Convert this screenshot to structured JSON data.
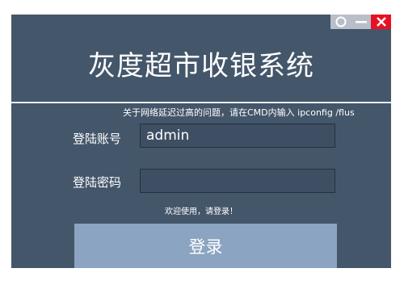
{
  "window": {
    "title": "灰度超市收银系统"
  },
  "controls": {
    "restore_icon": "circle-icon",
    "minimize_icon": "minimize-icon",
    "close_icon": "close-icon",
    "close_color": "#e81123"
  },
  "notice": "关于网络延迟过高的问题，请在CMD内输入 ipconfig /flus",
  "form": {
    "account_label": "登陆账号",
    "account_value": "admin",
    "password_label": "登陆密码",
    "password_value": ""
  },
  "welcome": "欢迎使用，请登录！",
  "login_button": "登录",
  "colors": {
    "background": "#44566a",
    "button": "#8aa4c1",
    "divider": "#e9eef3"
  }
}
